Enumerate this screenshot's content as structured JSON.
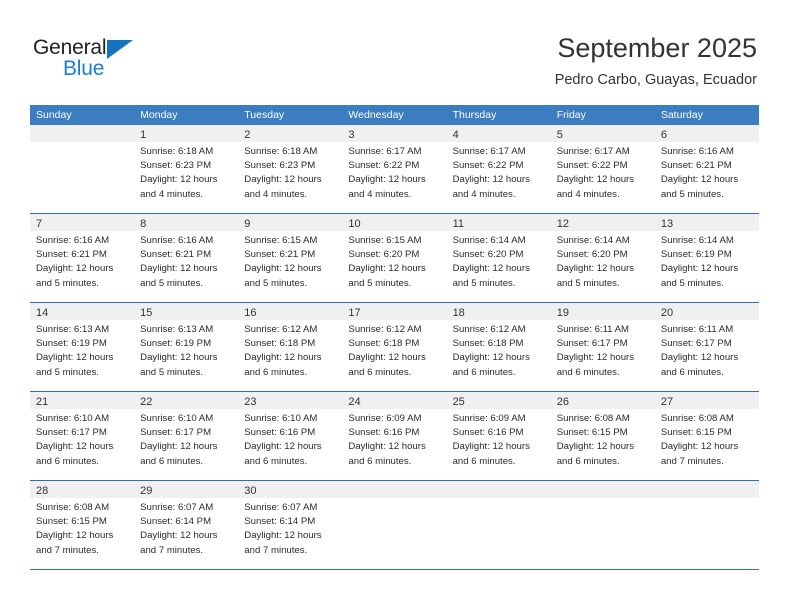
{
  "logo": {
    "word_top": "General",
    "word_bottom": "Blue",
    "triangle_icon": "blue-triangle-icon",
    "color_dark": "#231f20",
    "color_blue": "#1b7fd4"
  },
  "header": {
    "title": "September 2025",
    "subtitle": "Pedro Carbo, Guayas, Ecuador"
  },
  "theme": {
    "header_blue": "#3b7dc0",
    "divider_blue": "#2f6db4",
    "day_band_gray": "#f0f0f0"
  },
  "weekdays": [
    "Sunday",
    "Monday",
    "Tuesday",
    "Wednesday",
    "Thursday",
    "Friday",
    "Saturday"
  ],
  "weeks": [
    [
      {
        "day": "",
        "lines": []
      },
      {
        "day": "1",
        "lines": [
          "Sunrise: 6:18 AM",
          "Sunset: 6:23 PM",
          "Daylight: 12 hours",
          "and 4 minutes."
        ]
      },
      {
        "day": "2",
        "lines": [
          "Sunrise: 6:18 AM",
          "Sunset: 6:23 PM",
          "Daylight: 12 hours",
          "and 4 minutes."
        ]
      },
      {
        "day": "3",
        "lines": [
          "Sunrise: 6:17 AM",
          "Sunset: 6:22 PM",
          "Daylight: 12 hours",
          "and 4 minutes."
        ]
      },
      {
        "day": "4",
        "lines": [
          "Sunrise: 6:17 AM",
          "Sunset: 6:22 PM",
          "Daylight: 12 hours",
          "and 4 minutes."
        ]
      },
      {
        "day": "5",
        "lines": [
          "Sunrise: 6:17 AM",
          "Sunset: 6:22 PM",
          "Daylight: 12 hours",
          "and 4 minutes."
        ]
      },
      {
        "day": "6",
        "lines": [
          "Sunrise: 6:16 AM",
          "Sunset: 6:21 PM",
          "Daylight: 12 hours",
          "and 5 minutes."
        ]
      }
    ],
    [
      {
        "day": "7",
        "lines": [
          "Sunrise: 6:16 AM",
          "Sunset: 6:21 PM",
          "Daylight: 12 hours",
          "and 5 minutes."
        ]
      },
      {
        "day": "8",
        "lines": [
          "Sunrise: 6:16 AM",
          "Sunset: 6:21 PM",
          "Daylight: 12 hours",
          "and 5 minutes."
        ]
      },
      {
        "day": "9",
        "lines": [
          "Sunrise: 6:15 AM",
          "Sunset: 6:21 PM",
          "Daylight: 12 hours",
          "and 5 minutes."
        ]
      },
      {
        "day": "10",
        "lines": [
          "Sunrise: 6:15 AM",
          "Sunset: 6:20 PM",
          "Daylight: 12 hours",
          "and 5 minutes."
        ]
      },
      {
        "day": "11",
        "lines": [
          "Sunrise: 6:14 AM",
          "Sunset: 6:20 PM",
          "Daylight: 12 hours",
          "and 5 minutes."
        ]
      },
      {
        "day": "12",
        "lines": [
          "Sunrise: 6:14 AM",
          "Sunset: 6:20 PM",
          "Daylight: 12 hours",
          "and 5 minutes."
        ]
      },
      {
        "day": "13",
        "lines": [
          "Sunrise: 6:14 AM",
          "Sunset: 6:19 PM",
          "Daylight: 12 hours",
          "and 5 minutes."
        ]
      }
    ],
    [
      {
        "day": "14",
        "lines": [
          "Sunrise: 6:13 AM",
          "Sunset: 6:19 PM",
          "Daylight: 12 hours",
          "and 5 minutes."
        ]
      },
      {
        "day": "15",
        "lines": [
          "Sunrise: 6:13 AM",
          "Sunset: 6:19 PM",
          "Daylight: 12 hours",
          "and 5 minutes."
        ]
      },
      {
        "day": "16",
        "lines": [
          "Sunrise: 6:12 AM",
          "Sunset: 6:18 PM",
          "Daylight: 12 hours",
          "and 6 minutes."
        ]
      },
      {
        "day": "17",
        "lines": [
          "Sunrise: 6:12 AM",
          "Sunset: 6:18 PM",
          "Daylight: 12 hours",
          "and 6 minutes."
        ]
      },
      {
        "day": "18",
        "lines": [
          "Sunrise: 6:12 AM",
          "Sunset: 6:18 PM",
          "Daylight: 12 hours",
          "and 6 minutes."
        ]
      },
      {
        "day": "19",
        "lines": [
          "Sunrise: 6:11 AM",
          "Sunset: 6:17 PM",
          "Daylight: 12 hours",
          "and 6 minutes."
        ]
      },
      {
        "day": "20",
        "lines": [
          "Sunrise: 6:11 AM",
          "Sunset: 6:17 PM",
          "Daylight: 12 hours",
          "and 6 minutes."
        ]
      }
    ],
    [
      {
        "day": "21",
        "lines": [
          "Sunrise: 6:10 AM",
          "Sunset: 6:17 PM",
          "Daylight: 12 hours",
          "and 6 minutes."
        ]
      },
      {
        "day": "22",
        "lines": [
          "Sunrise: 6:10 AM",
          "Sunset: 6:17 PM",
          "Daylight: 12 hours",
          "and 6 minutes."
        ]
      },
      {
        "day": "23",
        "lines": [
          "Sunrise: 6:10 AM",
          "Sunset: 6:16 PM",
          "Daylight: 12 hours",
          "and 6 minutes."
        ]
      },
      {
        "day": "24",
        "lines": [
          "Sunrise: 6:09 AM",
          "Sunset: 6:16 PM",
          "Daylight: 12 hours",
          "and 6 minutes."
        ]
      },
      {
        "day": "25",
        "lines": [
          "Sunrise: 6:09 AM",
          "Sunset: 6:16 PM",
          "Daylight: 12 hours",
          "and 6 minutes."
        ]
      },
      {
        "day": "26",
        "lines": [
          "Sunrise: 6:08 AM",
          "Sunset: 6:15 PM",
          "Daylight: 12 hours",
          "and 6 minutes."
        ]
      },
      {
        "day": "27",
        "lines": [
          "Sunrise: 6:08 AM",
          "Sunset: 6:15 PM",
          "Daylight: 12 hours",
          "and 7 minutes."
        ]
      }
    ],
    [
      {
        "day": "28",
        "lines": [
          "Sunrise: 6:08 AM",
          "Sunset: 6:15 PM",
          "Daylight: 12 hours",
          "and 7 minutes."
        ]
      },
      {
        "day": "29",
        "lines": [
          "Sunrise: 6:07 AM",
          "Sunset: 6:14 PM",
          "Daylight: 12 hours",
          "and 7 minutes."
        ]
      },
      {
        "day": "30",
        "lines": [
          "Sunrise: 6:07 AM",
          "Sunset: 6:14 PM",
          "Daylight: 12 hours",
          "and 7 minutes."
        ]
      },
      {
        "day": "",
        "lines": []
      },
      {
        "day": "",
        "lines": []
      },
      {
        "day": "",
        "lines": []
      },
      {
        "day": "",
        "lines": []
      }
    ]
  ]
}
